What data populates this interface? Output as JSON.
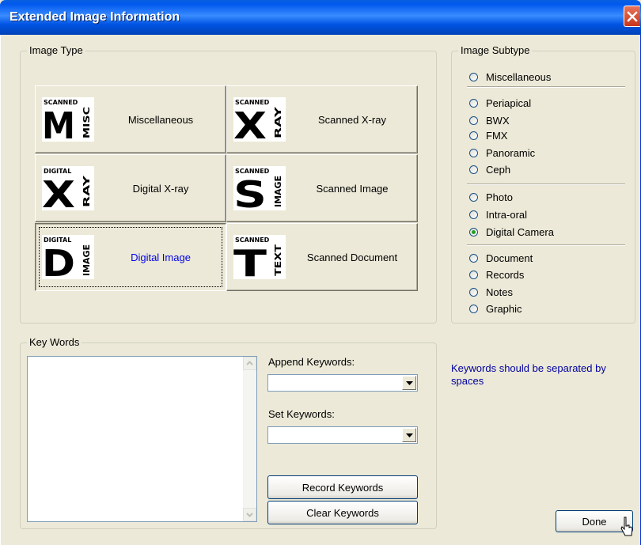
{
  "window": {
    "title": "Extended Image Information"
  },
  "image_type": {
    "legend": "Image Type",
    "buttons": [
      {
        "label": "Miscellaneous",
        "logo_top": "SCANNED",
        "logo_big": "M",
        "logo_side": "MISC",
        "selected": false
      },
      {
        "label": "Scanned X-ray",
        "logo_top": "SCANNED",
        "logo_big": "X",
        "logo_side": "RAY",
        "selected": false
      },
      {
        "label": "Digital X-ray",
        "logo_top": "DIGITAL",
        "logo_big": "X",
        "logo_side": "RAY",
        "selected": false
      },
      {
        "label": "Scanned Image",
        "logo_top": "SCANNED",
        "logo_big": "S",
        "logo_side": "IMAGE",
        "selected": false
      },
      {
        "label": "Digital Image",
        "logo_top": "DIGITAL",
        "logo_big": "D",
        "logo_side": "IMAGE",
        "selected": true
      },
      {
        "label": "Scanned Document",
        "logo_top": "SCANNED",
        "logo_big": "T",
        "logo_side": "TEXT",
        "selected": false
      }
    ]
  },
  "image_subtype": {
    "legend": "Image Subtype",
    "options": [
      "Miscellaneous",
      "Periapical",
      "BWX",
      "FMX",
      "Panoramic",
      "Ceph",
      "Photo",
      "Intra-oral",
      "Digital Camera",
      "Document",
      "Records",
      "Notes",
      "Graphic"
    ],
    "selected": "Digital Camera"
  },
  "key_words": {
    "legend": "Key Words",
    "text": "",
    "append_label": "Append Keywords:",
    "append_value": "",
    "set_label": "Set Keywords:",
    "set_value": "",
    "record_button": "Record Keywords",
    "clear_button": "Clear Keywords"
  },
  "note": "Keywords should be separated by spaces",
  "done_button": "Done",
  "colors": {
    "titlebar": "#0054E3",
    "face": "#ECE9D8",
    "selected_label": "#0000E8",
    "note_text": "#0000A0",
    "radio_on": "#21A121"
  },
  "icons": [
    "close-icon",
    "dropdown-arrow-icon",
    "scroll-up-icon",
    "scroll-down-icon",
    "mouse-cursor-icon"
  ]
}
